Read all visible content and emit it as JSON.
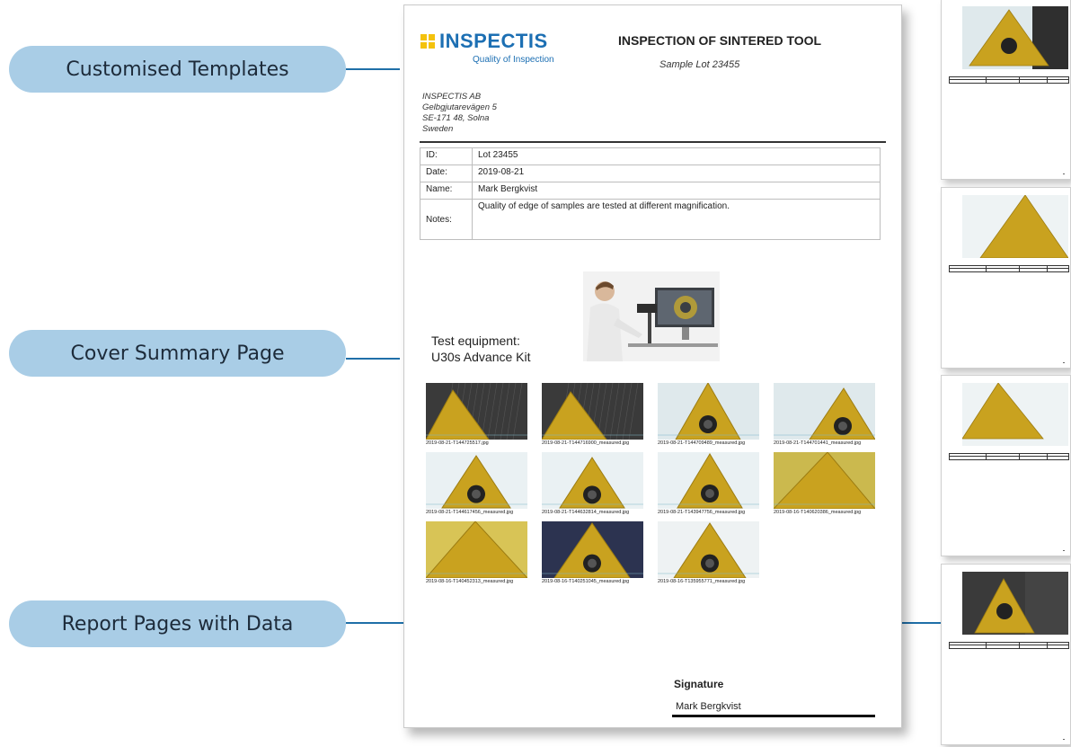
{
  "callouts": [
    {
      "label": "Customised Templates"
    },
    {
      "label": "Cover Summary Page"
    },
    {
      "label": "Report Pages with Data"
    }
  ],
  "report": {
    "logo_text": "INSPECTIS",
    "tagline": "Quality of Inspection",
    "title": "INSPECTION OF SINTERED TOOL",
    "subtitle": "Sample Lot 23455",
    "address": {
      "line1": "INSPECTIS AB",
      "line2": "Gelbgjutarevägen 5",
      "line3": "SE-171 48, Solna",
      "line4": "Sweden"
    },
    "info": {
      "id_label": "ID:",
      "id_value": "Lot 23455",
      "date_label": "Date:",
      "date_value": "2019-08-21",
      "name_label": "Name:",
      "name_value": "Mark Bergkvist",
      "notes_label": "Notes:",
      "notes_value": "Quality of edge of samples are tested at different magnification."
    },
    "equipment": {
      "line1": "Test equipment:",
      "line2": "U30s Advance Kit"
    },
    "thumbnails": [
      "2019-08-21-T144725517.jpg",
      "2019-08-21-T144716900_measured.jpg",
      "2019-08-21-T144709489_measured.jpg",
      "2019-08-21-T144701441_measured.jpg",
      "2019-08-21-T144617456_measured.jpg",
      "2019-08-21-T144632814_measured.jpg",
      "2019-08-21-T143947756_measured.jpg",
      "2019-08-16-T140620386_measured.jpg",
      "2019-08-16-T140452313_measured.jpg",
      "2019-08-16-T140251045_measured.jpg",
      "2019-08-16-T135955771_measured.jpg"
    ],
    "signature_label": "Signature",
    "signature_name": "Mark Bergkvist"
  },
  "colors": {
    "pill": "#a9cde6",
    "connector": "#1f6fa8",
    "brand_blue": "#1c6fb3",
    "brand_yellow": "#f4c20d",
    "insert_gold": "#c9a21f"
  }
}
